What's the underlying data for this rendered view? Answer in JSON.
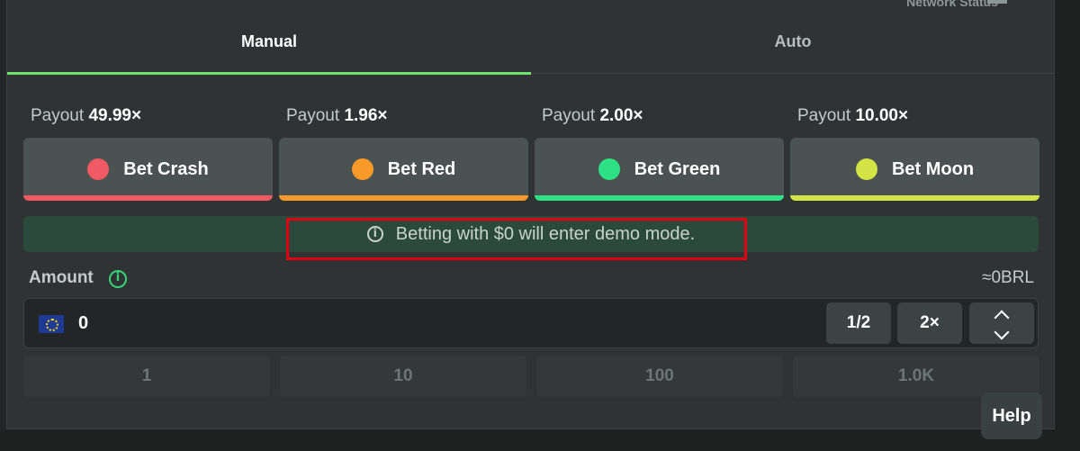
{
  "header": {
    "network_status": "Network Status"
  },
  "tabs": [
    {
      "label": "Manual",
      "active": true
    },
    {
      "label": "Auto",
      "active": false
    }
  ],
  "bets": [
    {
      "payout_label": "Payout",
      "payout_value": "49.99×",
      "label": "Bet Crash",
      "color": "#f05a64"
    },
    {
      "payout_label": "Payout",
      "payout_value": "1.96×",
      "label": "Bet Red",
      "color": "#f79a2a"
    },
    {
      "payout_label": "Payout",
      "payout_value": "2.00×",
      "label": "Bet Green",
      "color": "#2fe186"
    },
    {
      "payout_label": "Payout",
      "payout_value": "10.00×",
      "label": "Bet Moon",
      "color": "#d4e447"
    }
  ],
  "demo_notice": "Betting with $0 will enter demo mode.",
  "amount": {
    "label": "Amount",
    "conversion": "≈0BRL",
    "value": "0",
    "currency_icon": "eu-flag-icon",
    "half_label": "1/2",
    "double_label": "2×"
  },
  "quick_amounts": [
    "1",
    "10",
    "100",
    "1.0K"
  ],
  "help_label": "Help",
  "colors": {
    "accent": "#6fe36f",
    "highlight": "#e0000f",
    "demo_bg": "#2c4a3b"
  }
}
